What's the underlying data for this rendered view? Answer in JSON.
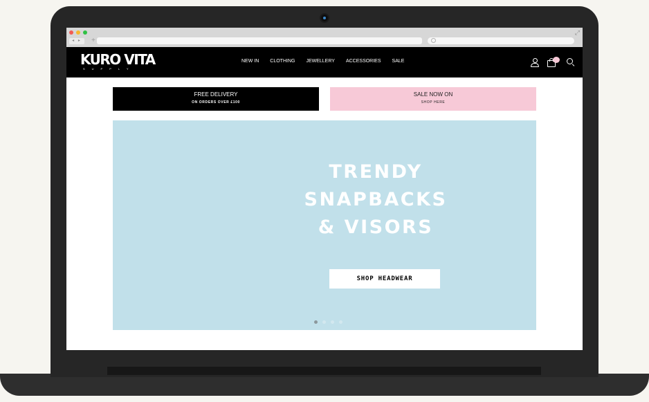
{
  "browser": {
    "plus_icon": "+",
    "expand_icon": "⤢",
    "nav_arrows": "◂ ▸"
  },
  "header": {
    "logo_main": "KURO VITA",
    "logo_sub": "SUPPLY",
    "nav_items": [
      {
        "label": "NEW IN"
      },
      {
        "label": "CLOTHING"
      },
      {
        "label": "JEWELLERY"
      },
      {
        "label": "ACCESSORIES"
      },
      {
        "label": "SALE"
      }
    ],
    "icons": [
      "user-icon",
      "shopping-bag-icon",
      "search-icon"
    ],
    "cart_badge_color": "#f7c9d7"
  },
  "promos": {
    "delivery": {
      "title": "FREE DELIVERY",
      "subtitle": "ON ORDERS OVER £100",
      "background": "#000000"
    },
    "sale": {
      "title": "SALE NOW ON",
      "subtitle": "SHOP HERE",
      "background": "#f7c9d7"
    }
  },
  "hero": {
    "background": "#c1e0ea",
    "heading_lines": [
      "TRENDY",
      "SNAPBACKS",
      "& VISORS"
    ],
    "cta_label": "SHOP HEADWEAR",
    "slide_count": 4,
    "active_slide": 1
  }
}
